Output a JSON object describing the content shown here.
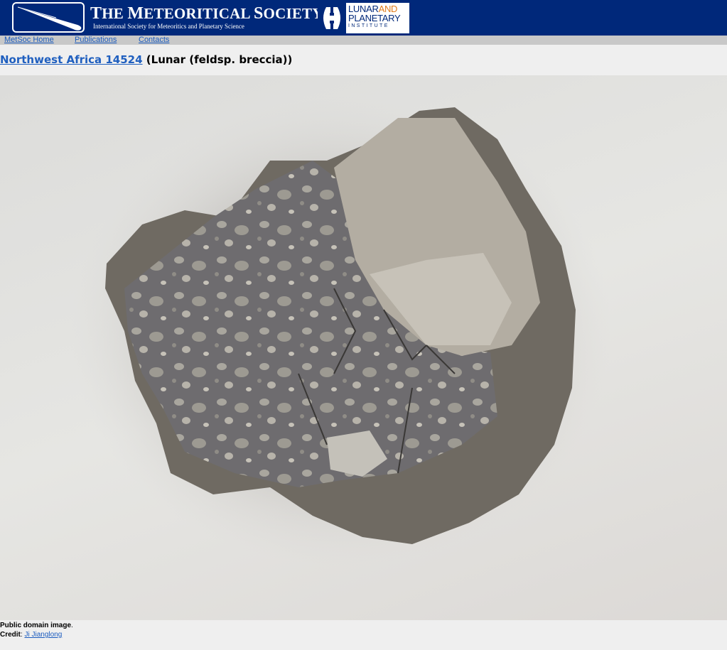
{
  "header": {
    "metsoc_title_big1": "T",
    "metsoc_title_rest1": "HE ",
    "metsoc_title_big2": "M",
    "metsoc_title_rest2": "ETEORITICAL ",
    "metsoc_title_big3": "S",
    "metsoc_title_rest3": "OCIETY",
    "metsoc_subtitle": "International Society for Meteoritics and Planetary Science",
    "lpi_line1_a": "LUNAR",
    "lpi_line1_b": "AND",
    "lpi_line2": "PLANETARY",
    "lpi_line3": "INSTITUTE"
  },
  "nav": {
    "items": [
      "MetSoc Home",
      "Publications",
      "Contacts"
    ]
  },
  "page": {
    "meteorite_name": "Northwest Africa 14524",
    "classification": " (Lunar (feldsp. breccia))"
  },
  "caption": {
    "license": "Public domain image",
    "license_suffix": ".",
    "credit_label": "Credit",
    "credit_sep": ": ",
    "credit_name": "Ji Jianglong"
  },
  "colors": {
    "banner": "#00287a",
    "link": "#1a5bbf",
    "lpi_and": "#e07b1a"
  }
}
